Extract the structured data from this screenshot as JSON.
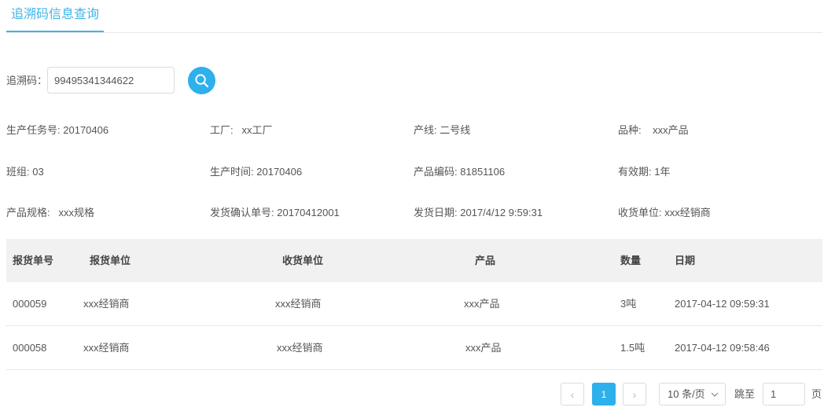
{
  "tab": {
    "label": "追溯码信息查询"
  },
  "search": {
    "label": "追溯码：",
    "value": "99495341344622"
  },
  "info": [
    {
      "label": "生产任务号:",
      "value": "20170406"
    },
    {
      "label": "工厂:",
      "value": "xx工厂"
    },
    {
      "label": "产线:",
      "value": "二号线"
    },
    {
      "label": "品种:",
      "value": "xxx产品"
    },
    {
      "label": "班组:",
      "value": "03"
    },
    {
      "label": "生产时间:",
      "value": "20170406"
    },
    {
      "label": "产品编码:",
      "value": "81851106"
    },
    {
      "label": "有效期:",
      "value": "1年"
    },
    {
      "label": "产品规格:",
      "value": "xxx规格"
    },
    {
      "label": "发货确认单号:",
      "value": "20170412001"
    },
    {
      "label": "发货日期:",
      "value": "2017/4/12 9:59:31"
    },
    {
      "label": "收货单位:",
      "value": "xxx经销商"
    }
  ],
  "table": {
    "columns": [
      "报货单号",
      "报货单位",
      "收货单位",
      "产品",
      "数量",
      "日期"
    ],
    "rows": [
      [
        "000059",
        "xxx经销商",
        "xxx经销商",
        "xxx产品",
        "3吨",
        "2017-04-12 09:59:31"
      ],
      [
        "000058",
        "xxx经销商",
        "xxx经销商",
        "xxx产品",
        "1.5吨",
        "2017-04-12 09:58:46"
      ]
    ]
  },
  "pagination": {
    "prev": "‹",
    "current": "1",
    "next": "›",
    "page_size": "10 条/页",
    "jump_label": "跳至",
    "jump_value": "1",
    "page_suffix": "页"
  }
}
